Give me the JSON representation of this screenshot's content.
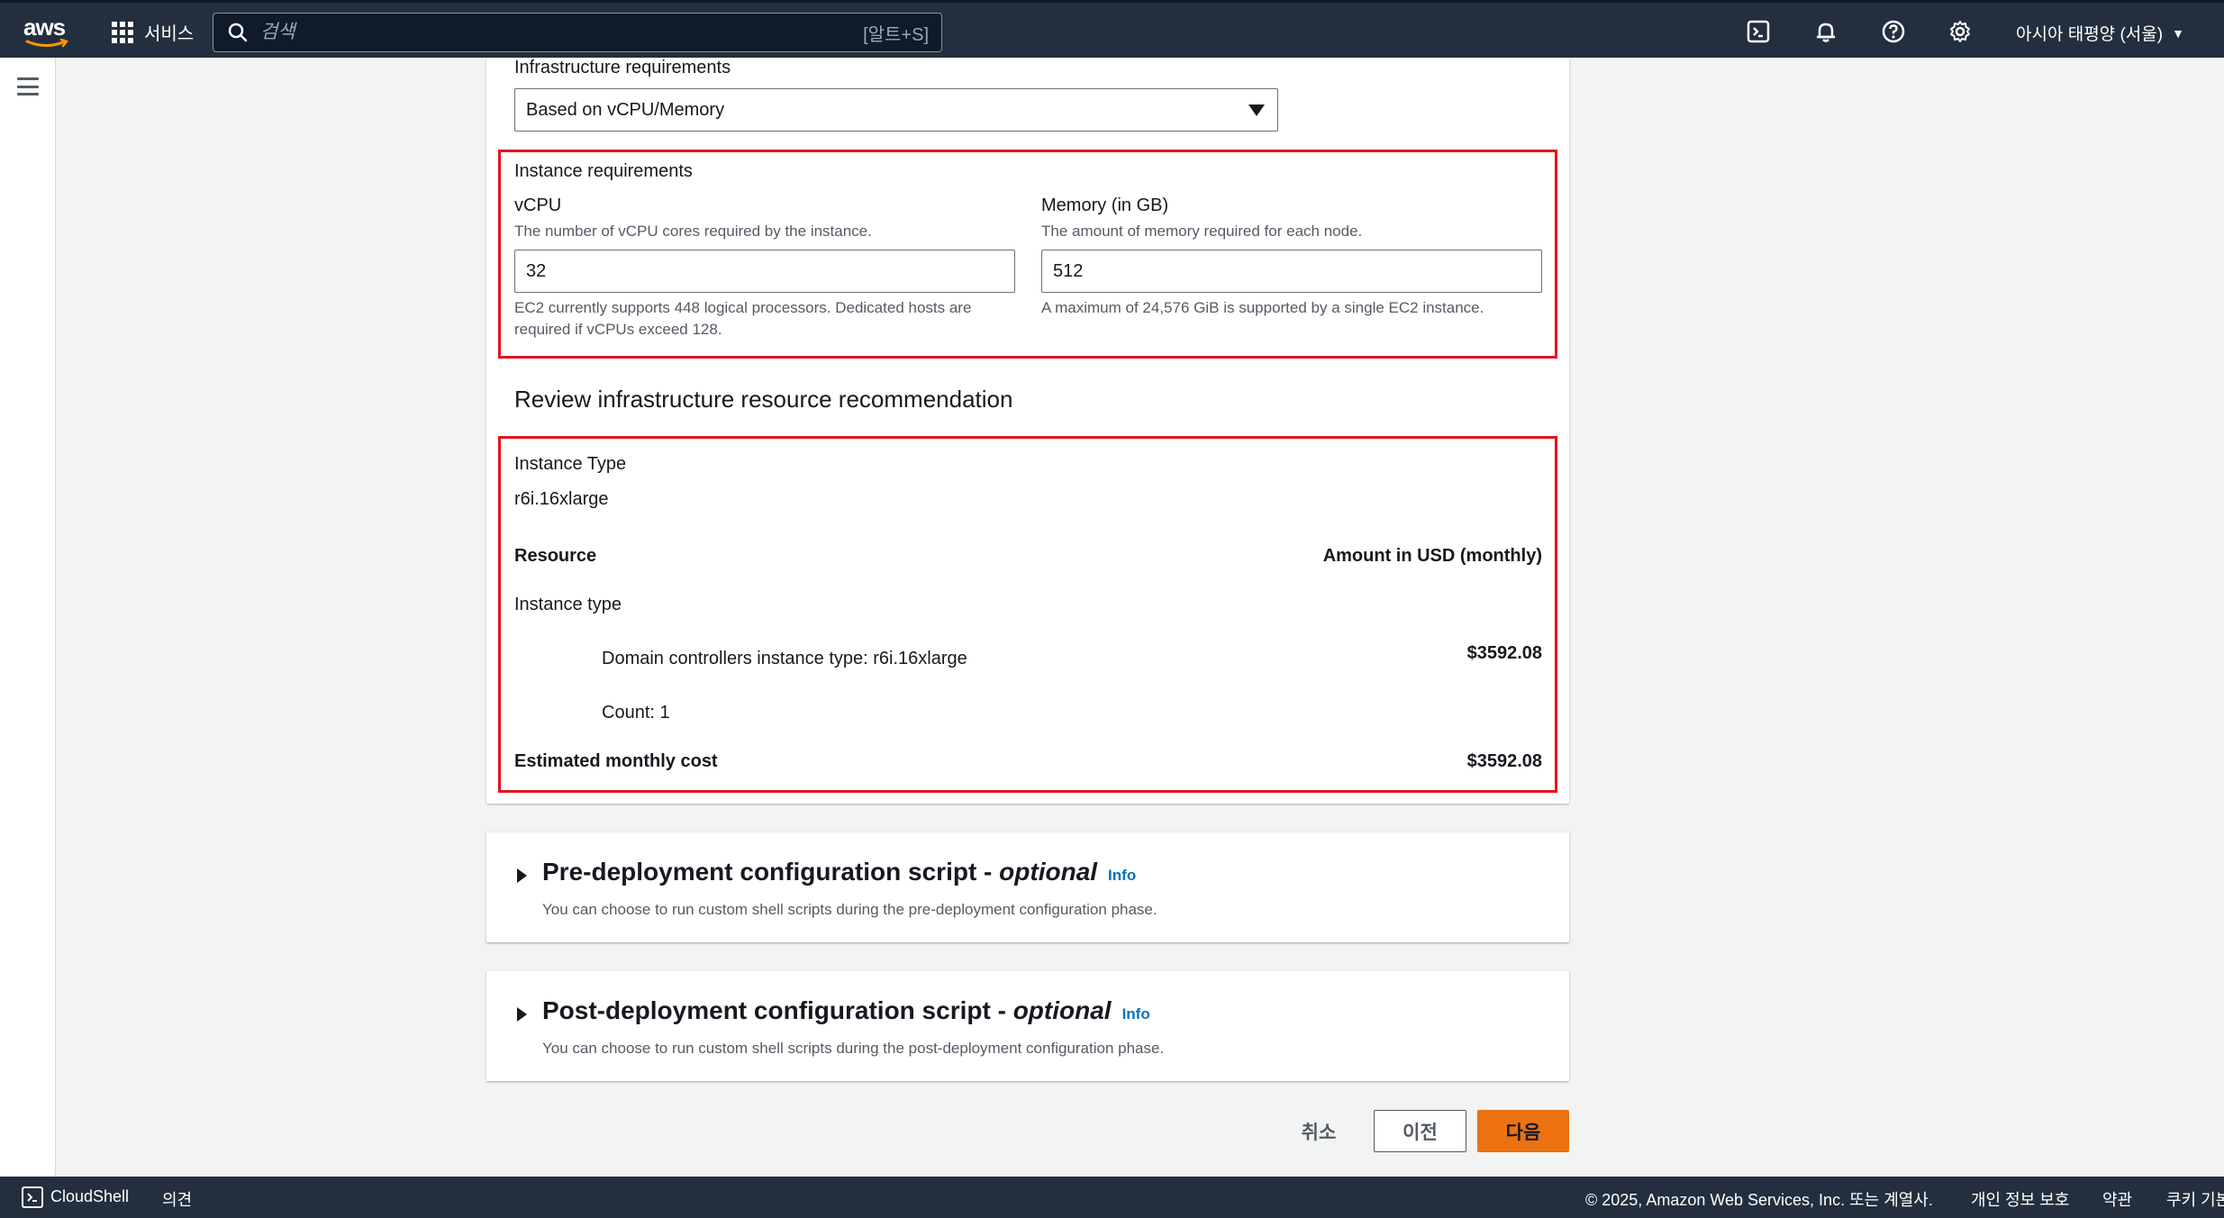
{
  "topnav": {
    "logo_text": "aws",
    "services_label": "서비스",
    "search_placeholder": "검색",
    "search_shortcut": "[알트+S]",
    "region_label": "아시아 태평양 (서울)",
    "icons": [
      "cloudshell-icon",
      "bell-icon",
      "help-icon",
      "gear-icon"
    ]
  },
  "form": {
    "infra_label": "Infrastructure requirements",
    "infra_value": "Based on vCPU/Memory",
    "instance_req_label": "Instance requirements",
    "vcpu": {
      "label": "vCPU",
      "description": "The number of vCPU cores required by the instance.",
      "value": "32",
      "hint_line1": "EC2 currently supports 448 logical processors. Dedicated hosts are",
      "hint_line2": "required if vCPUs exceed 128."
    },
    "memory": {
      "label": "Memory (in GB)",
      "description": "The amount of memory required for each node.",
      "value": "512",
      "hint": "A maximum of 24,576 GiB is supported by a single EC2 instance."
    }
  },
  "review": {
    "heading": "Review infrastructure resource recommendation",
    "instance_type_label": "Instance Type",
    "instance_type_value": "r6i.16xlarge",
    "col_resource": "Resource",
    "col_amount": "Amount in USD (monthly)",
    "group_label": "Instance type",
    "row_label": "Domain controllers instance type: r6i.16xlarge",
    "row_amount": "$3592.08",
    "count_label": "Count: 1",
    "total_label": "Estimated monthly cost",
    "total_amount": "$3592.08"
  },
  "pre_script": {
    "title": "Pre-deployment configuration script - ",
    "optional": "optional",
    "info": "Info",
    "description": "You can choose to run custom shell scripts during the pre-deployment configuration phase."
  },
  "post_script": {
    "title": "Post-deployment configuration script - ",
    "optional": "optional",
    "info": "Info",
    "description": "You can choose to run custom shell scripts during the post-deployment configuration phase."
  },
  "actions": {
    "cancel": "취소",
    "previous": "이전",
    "next": "다음"
  },
  "footer": {
    "cloudshell": "CloudShell",
    "feedback": "의견",
    "copyright": "© 2025, Amazon Web Services, Inc. 또는 계열사.",
    "privacy": "개인 정보 보호",
    "terms": "약관",
    "cookies": "쿠키 기본"
  },
  "colors": {
    "nav_bg": "#232f3e",
    "primary": "#ec7211",
    "highlight": "#e1141e",
    "link": "#0073bb"
  }
}
